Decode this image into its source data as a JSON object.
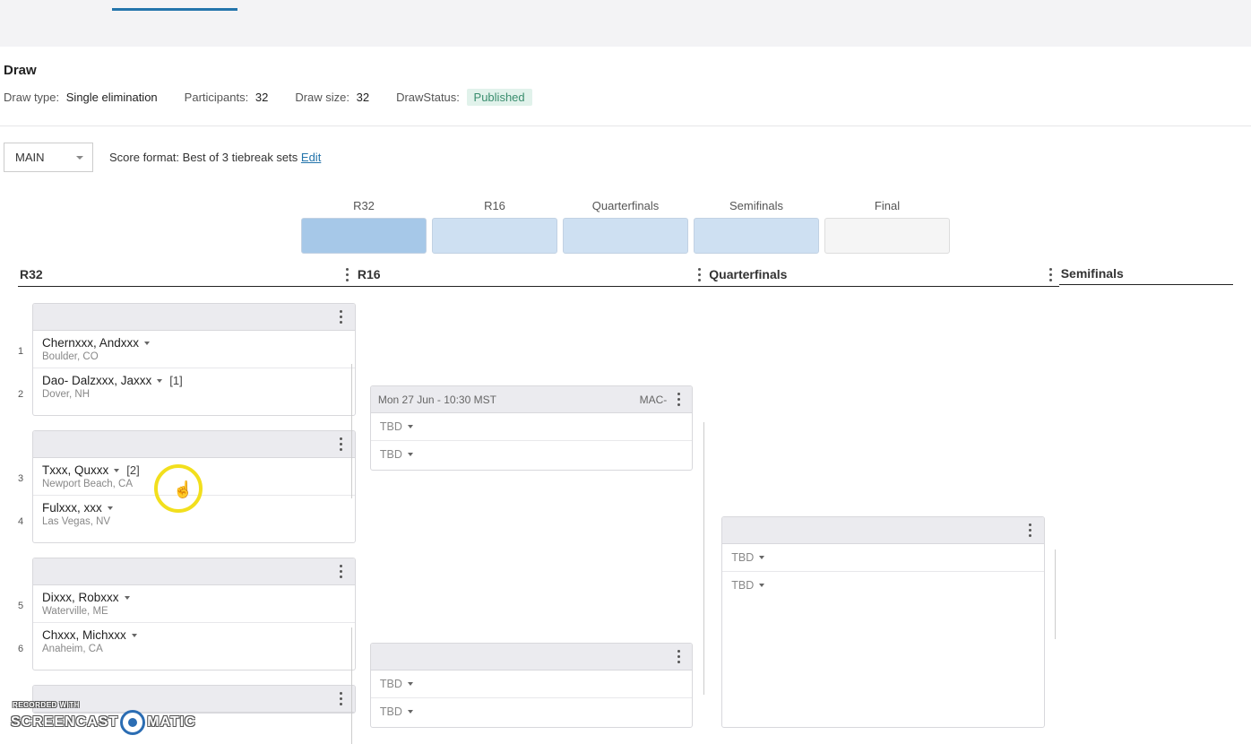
{
  "page": {
    "draw_title": "Draw"
  },
  "meta": {
    "draw_type_label": "Draw type:",
    "draw_type_value": "Single elimination",
    "participants_label": "Participants:",
    "participants_value": "32",
    "draw_size_label": "Draw size:",
    "draw_size_value": "32",
    "draw_status_label": "DrawStatus:",
    "draw_status_value": "Published"
  },
  "controls": {
    "stage_select": "MAIN",
    "score_format_label": "Score format:",
    "score_format_value": "Best of 3 tiebreak sets",
    "edit_label": "Edit"
  },
  "round_nav": {
    "r32": "R32",
    "r16": "R16",
    "qf": "Quarterfinals",
    "sf": "Semifinals",
    "final": "Final"
  },
  "columns": {
    "r32": "R32",
    "r16": "R16",
    "qf": "Quarterfinals",
    "sf": "Semifinals"
  },
  "r32_matches": [
    {
      "p1": {
        "num": "1",
        "name": "Chernxxx, Andxxx",
        "loc": "Boulder, CO",
        "seed": ""
      },
      "p2": {
        "num": "2",
        "name": "Dao- Dalzxxx, Jaxxx",
        "loc": "Dover, NH",
        "seed": "[1]"
      }
    },
    {
      "p1": {
        "num": "3",
        "name": "Txxx, Quxxx",
        "loc": "Newport Beach, CA",
        "seed": "[2]"
      },
      "p2": {
        "num": "4",
        "name": "Fulxxx, xxx",
        "loc": "Las Vegas, NV",
        "seed": ""
      }
    },
    {
      "p1": {
        "num": "5",
        "name": "Dixxx, Robxxx",
        "loc": "Waterville, ME",
        "seed": ""
      },
      "p2": {
        "num": "6",
        "name": "Chxxx, Michxxx",
        "loc": "Anaheim, CA",
        "seed": ""
      }
    }
  ],
  "r16_matches": [
    {
      "schedule": "Mon 27 Jun - 10:30 MST",
      "court": "MAC-",
      "p1": "TBD",
      "p2": "TBD"
    },
    {
      "schedule": "",
      "court": "",
      "p1": "TBD",
      "p2": "TBD"
    }
  ],
  "qf_matches": [
    {
      "p1": "TBD",
      "p2": "TBD"
    }
  ],
  "watermark": {
    "pre": "RECORDED WITH",
    "part1": "SCREENCAST",
    "part2": "MATIC"
  }
}
